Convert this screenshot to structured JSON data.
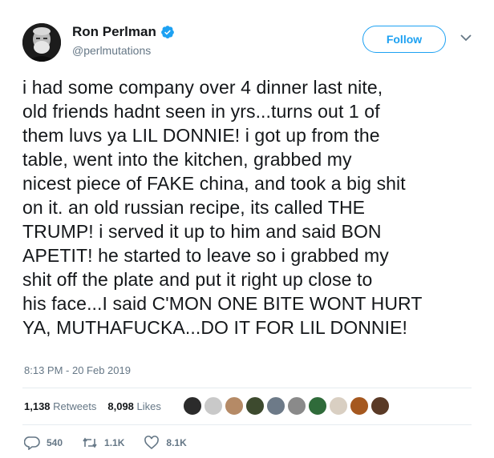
{
  "user": {
    "display_name": "Ron Perlman",
    "handle": "@perlmutations",
    "verified": true
  },
  "follow_label": "Follow",
  "tweet_text": "i had some company over 4 dinner last nite,\nold friends hadnt seen in yrs...turns out 1 of\nthem luvs ya LIL DONNIE! i got up from the\ntable, went into the kitchen, grabbed my\nnicest piece of FAKE china, and took a big shit\non it. an old russian recipe, its called THE\nTRUMP! i served it up to him and said BON\nAPETIT! he started to leave so i grabbed my\nshit off the plate and put it right up close to\nhis face...I said C'MON ONE BITE WONT HURT\nYA, MUTHAFUCKA...DO IT FOR LIL DONNIE!",
  "timestamp": "8:13 PM - 20 Feb 2019",
  "stats": {
    "retweets_count": "1,138",
    "retweets_label": "Retweets",
    "likes_count": "8,098",
    "likes_label": "Likes"
  },
  "likers": [
    {
      "color": "#2b2b2b"
    },
    {
      "color": "#c9c9c9"
    },
    {
      "color": "#b58a66"
    },
    {
      "color": "#3d4a2e"
    },
    {
      "color": "#6d7a88"
    },
    {
      "color": "#8a8a8a"
    },
    {
      "color": "#2f6b3a"
    },
    {
      "color": "#d9cfc2"
    },
    {
      "color": "#a5581f"
    },
    {
      "color": "#5a3a26"
    }
  ],
  "actions": {
    "reply_count": "540",
    "retweet_count": "1.1K",
    "like_count": "8.1K"
  },
  "colors": {
    "accent": "#1da1f2",
    "muted": "#657786",
    "text": "#14171a"
  }
}
